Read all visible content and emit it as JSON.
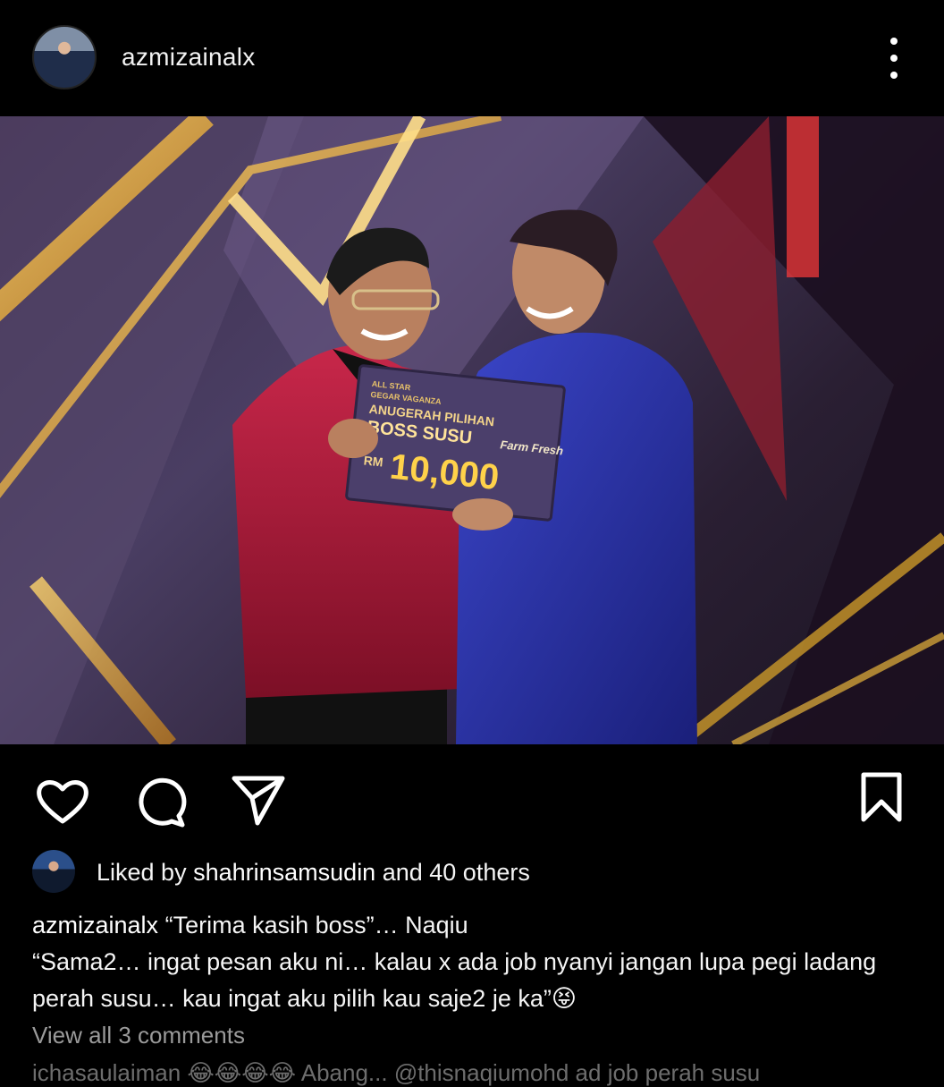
{
  "post": {
    "username": "azmizainalx",
    "image": {
      "board_title_line1": "ALL STAR",
      "board_title_line2": "GEGAR VAGANZA",
      "board_title_line3": "ANUGERAH PILIHAN",
      "board_heading": "BOSS SUSU",
      "board_currency": "RM",
      "board_amount": "10,000",
      "brand": "Farm Fresh"
    },
    "likes": {
      "prefix": "Liked by",
      "user": "shahrinsamsudin",
      "suffix": "and 40 others"
    },
    "caption": {
      "username": "azmizainalx",
      "line1": "“Terima kasih boss”… Naqiu",
      "line2": "“Sama2… ingat pesan aku ni… kalau x ada job nyanyi jangan lupa pegi ladang perah susu… kau ingat aku pilih kau saje2 je ka”😝"
    },
    "view_comments": "View all 3 comments",
    "next_comment": "ichasaulaiman 😂😂😂😂 Abang... @thisnaqiumohd ad job perah susu"
  },
  "icons": [
    "more-vertical-icon",
    "heart-icon",
    "comment-icon",
    "send-icon",
    "bookmark-icon"
  ],
  "colors": {
    "background": "#000000",
    "text": "#f5f5f5",
    "muted": "#9a9a9a",
    "board": "#4b3f6b",
    "gold": "#e8c26a"
  }
}
